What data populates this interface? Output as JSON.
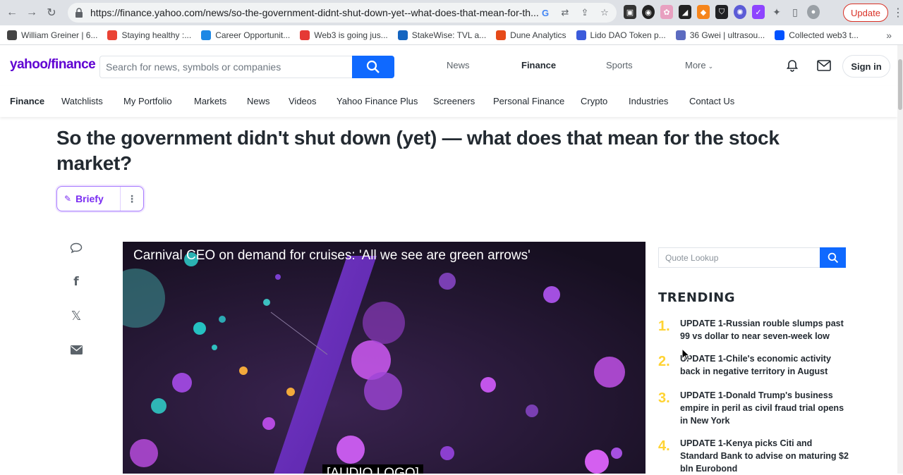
{
  "browser": {
    "url": "https://finance.yahoo.com/news/so-the-government-didnt-shut-down-yet--what-does-that-mean-for-th...",
    "update_label": "Update",
    "bookmarks": [
      {
        "label": "William Greiner | 6...",
        "color": "#444444"
      },
      {
        "label": "Staying healthy :...",
        "color": "#ea4335"
      },
      {
        "label": "Career Opportunit...",
        "color": "#1e88e5"
      },
      {
        "label": "Web3 is going jus...",
        "color": "#e53935"
      },
      {
        "label": "StakeWise: TVL a...",
        "color": "#1565c0"
      },
      {
        "label": "Dune Analytics",
        "color": "#e64a19"
      },
      {
        "label": "Lido DAO Token p...",
        "color": "#3b5bdb"
      },
      {
        "label": "36 Gwei | ultrasou...",
        "color": "#5c6bc0"
      },
      {
        "label": "Collected web3 t...",
        "color": "#0052ff"
      }
    ]
  },
  "header": {
    "logo": "yahoo/finance",
    "search_placeholder": "Search for news, symbols or companies",
    "nav": [
      "News",
      "Finance",
      "Sports",
      "More"
    ],
    "signin": "Sign in"
  },
  "subnav": [
    "Finance",
    "Watchlists",
    "My Portfolio",
    "Markets",
    "News",
    "Videos",
    "Yahoo Finance Plus",
    "Screeners",
    "Personal Finance",
    "Crypto",
    "Industries",
    "Contact Us"
  ],
  "article": {
    "headline": "So the government didn't shut down (yet) — what does that mean for the stock market?",
    "briefy_label": "Briefy"
  },
  "video": {
    "title": "Carnival CEO on demand for cruises: 'All we see are green arrows'",
    "caption": "[AUDIO LOGO]"
  },
  "sidebar": {
    "quote_placeholder": "Quote Lookup",
    "trending_title": "TRENDING",
    "trending": [
      {
        "num": "1.",
        "text": "UPDATE 1-Russian rouble slumps past 99 vs dollar to near seven-week low"
      },
      {
        "num": "2.",
        "text": "UPDATE 1-Chile's economic activity back in negative territory in August"
      },
      {
        "num": "3.",
        "text": "UPDATE 1-Donald Trump's business empire in peril as civil fraud trial opens in New York"
      },
      {
        "num": "4.",
        "text": "UPDATE 1-Kenya picks Citi and Standard Bank to advise on maturing $2 bln Eurobond"
      }
    ]
  },
  "colors": {
    "accent": "#6001d2",
    "search_blue": "#0f69ff",
    "trending_num": "#ffd333"
  }
}
